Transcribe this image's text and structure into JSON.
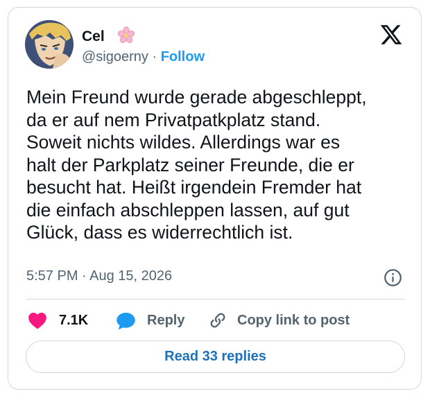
{
  "author": {
    "name": "Cel",
    "name_emoji": "cherry-blossom-icon",
    "handle": "@sigoerny",
    "separator": " · ",
    "follow_label": "Follow"
  },
  "tweet": {
    "text": "Mein Freund wurde gerade abgeschleppt,\nda er auf nem Privatpatkplatz stand.\nSoweit nichts wildes. Allerdings war es\nhalt der Parkplatz seiner Freunde, die er\nbesucht hat. Heißt irgendein Fremder hat\ndie einfach abschleppen lassen, auf gut\nGlück, dass es widerrechtlich ist.",
    "time": "5:57 PM",
    "date": "Aug 15, 2026",
    "time_separator": " · "
  },
  "actions": {
    "likes": "7.1K",
    "reply_label": "Reply",
    "copy_label": "Copy link to post"
  },
  "read_replies_label": "Read 33 replies",
  "colors": {
    "accent": "#1d9bf0",
    "like": "#f91880",
    "muted": "#536471",
    "border": "#cfd9de"
  }
}
